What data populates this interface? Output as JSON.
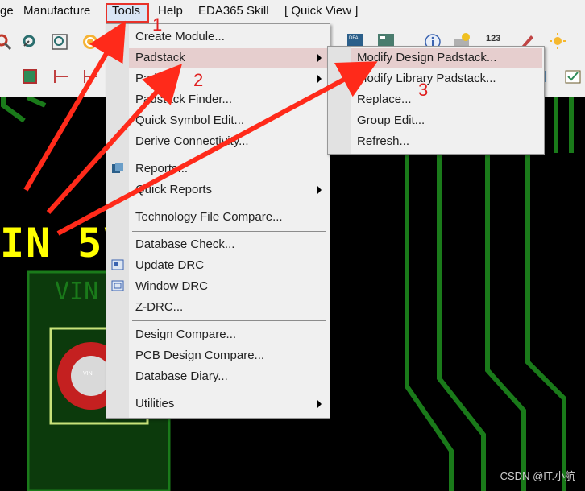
{
  "menubar": {
    "items": [
      "ge",
      "Manufacture",
      "Tools",
      "Help",
      "EDA365 Skill",
      "[ Quick View ]"
    ]
  },
  "toolbar": {
    "label_123": "123"
  },
  "tools_menu": {
    "items": [
      "Create Module...",
      "Padstack",
      "Pad",
      "Padstack Finder...",
      "Quick Symbol Edit...",
      "Derive Connectivity...",
      "Reports...",
      "Quick Reports",
      "Technology File Compare...",
      "Database Check...",
      "Update DRC",
      "Window DRC",
      "Z-DRC...",
      "Design Compare...",
      "PCB Design Compare...",
      "Database Diary...",
      "Utilities"
    ]
  },
  "padstack_submenu": {
    "items": [
      "Modify Design Padstack...",
      "Modify Library Padstack...",
      "Replace...",
      "Group Edit...",
      "Refresh..."
    ]
  },
  "canvas": {
    "net_label_large": "IN 5V",
    "net_label_small": "VIN",
    "pad_text": "VIN"
  },
  "annotations": {
    "step1": "1",
    "step2": "2",
    "step3": "3"
  },
  "watermark": "CSDN @IT.小航",
  "colors": {
    "trace": "#1a7a1a",
    "label": "#ffff00",
    "pad": "#c42020",
    "arrow": "#ff2a1a"
  }
}
